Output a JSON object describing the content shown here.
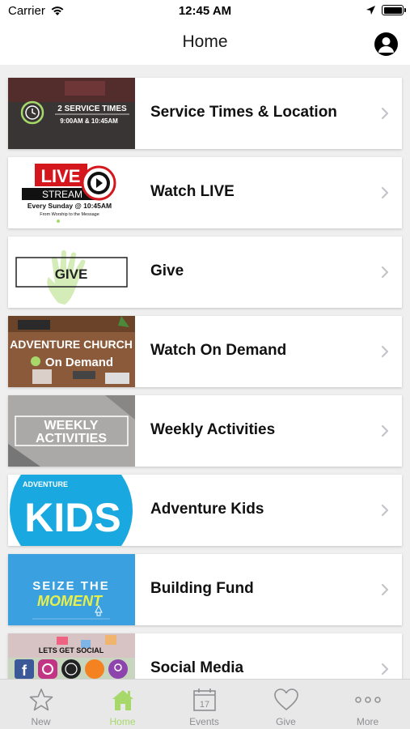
{
  "status_bar": {
    "carrier": "Carrier",
    "time": "12:45 AM"
  },
  "nav": {
    "title": "Home"
  },
  "menu": [
    {
      "label": "Service Times & Location",
      "thumb_lines": [
        "2 SERVICE TIMES",
        "9:00AM  &  10:45AM"
      ]
    },
    {
      "label": "Watch LIVE",
      "thumb_lines": [
        "LIVE",
        "STREAM",
        "Every Sunday @ 10:45AM",
        "From Worship to the Message"
      ]
    },
    {
      "label": "Give",
      "thumb_lines": [
        "GIVE"
      ]
    },
    {
      "label": "Watch On Demand",
      "thumb_lines": [
        "ADVENTURE CHURCH",
        "On Demand"
      ]
    },
    {
      "label": "Weekly Activities",
      "thumb_lines": [
        "WEEKLY",
        "ACTIVITIES"
      ]
    },
    {
      "label": "Adventure Kids",
      "thumb_lines": [
        "ADVENTURE",
        "KIDS"
      ]
    },
    {
      "label": "Building Fund",
      "thumb_lines": [
        "SEIZE THE",
        "MOMENT"
      ]
    },
    {
      "label": "Social Media",
      "thumb_lines": [
        "LETS GET SOCIAL"
      ]
    }
  ],
  "tabs": [
    {
      "label": "New",
      "icon": "star-icon"
    },
    {
      "label": "Home",
      "icon": "home-icon"
    },
    {
      "label": "Events",
      "icon": "calendar-icon",
      "day": "17"
    },
    {
      "label": "Give",
      "icon": "heart-icon"
    },
    {
      "label": "More",
      "icon": "more-icon"
    }
  ],
  "colors": {
    "accent": "#a6d96a",
    "inactive": "#8e8e93",
    "kids_blue": "#1aa8e0",
    "fund_blue": "#3aa0e0"
  }
}
